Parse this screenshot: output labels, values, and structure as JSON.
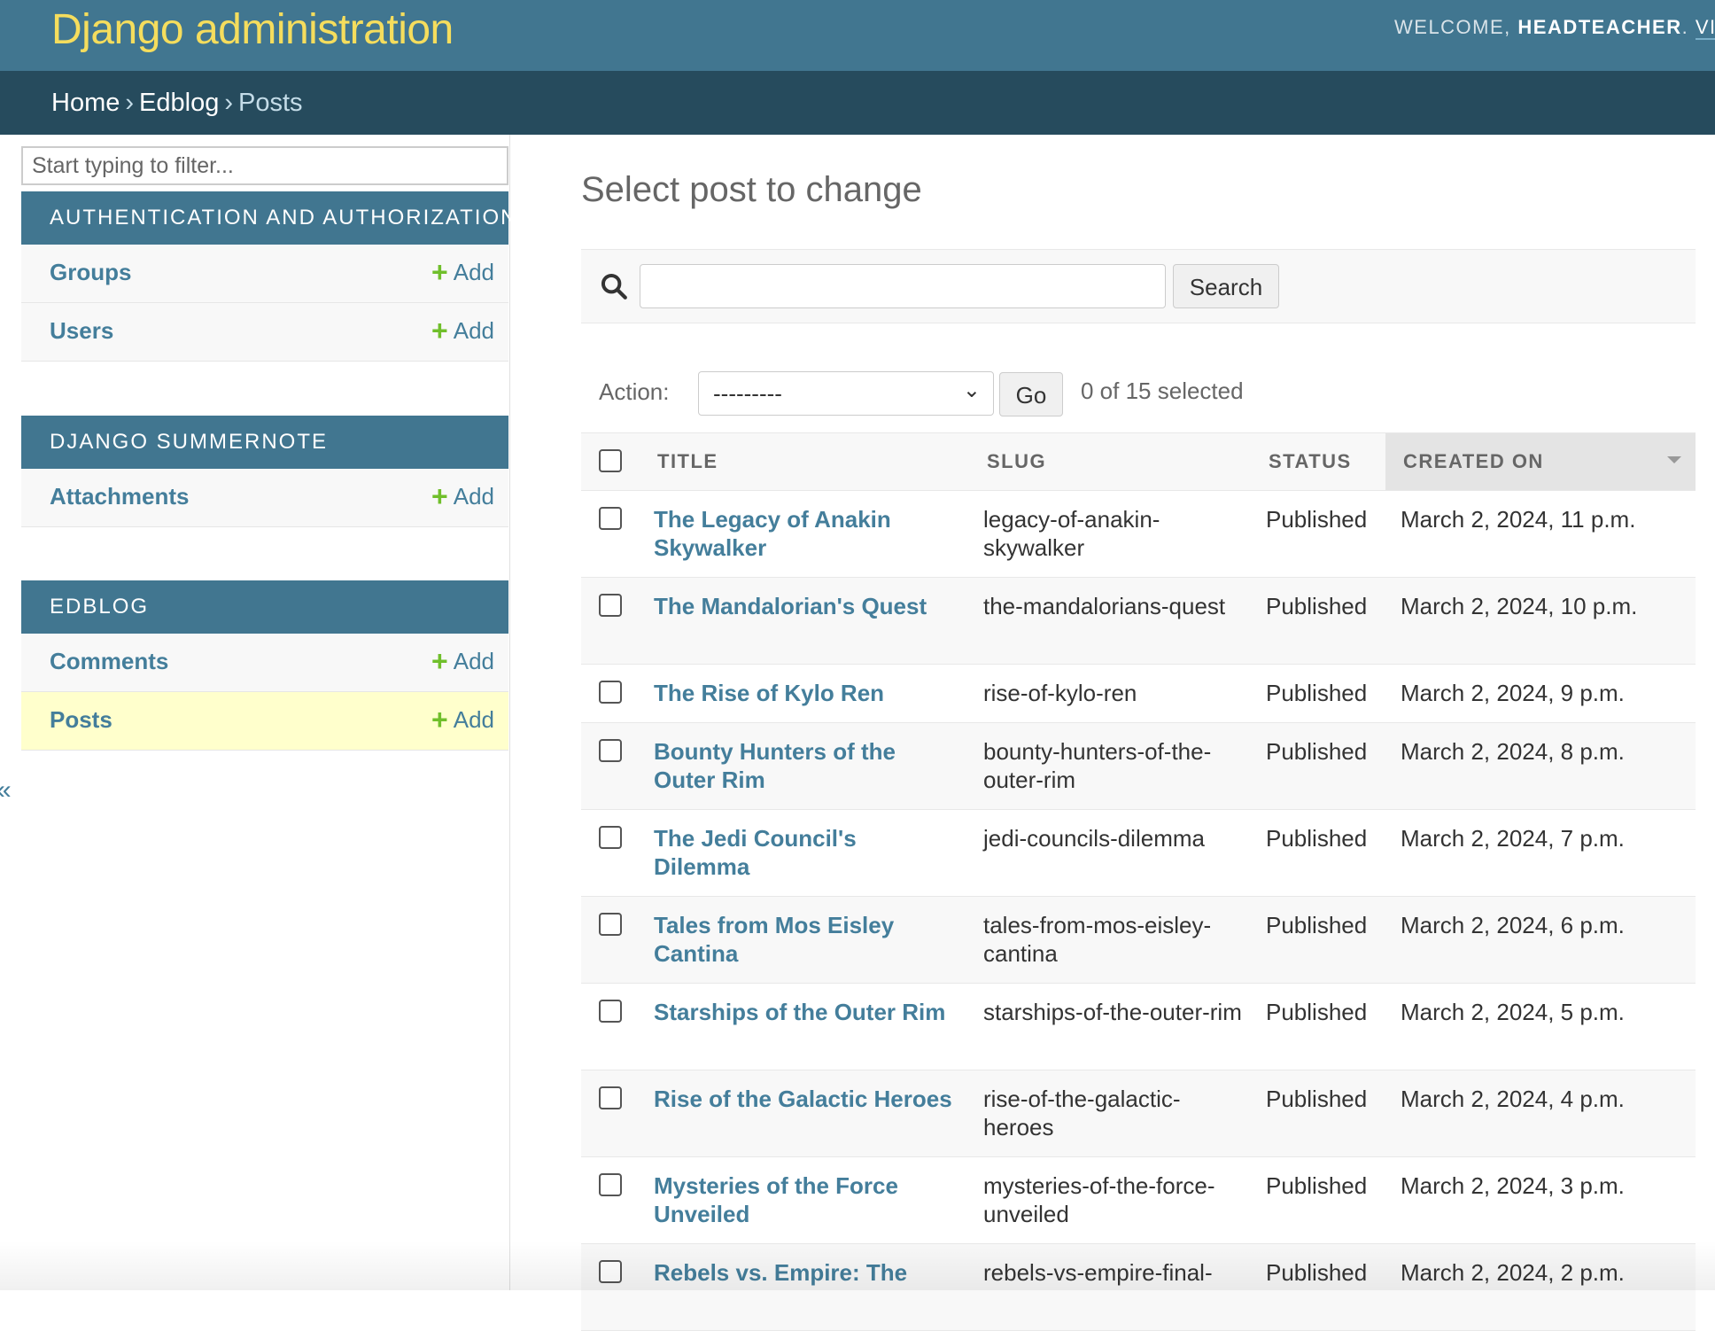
{
  "header": {
    "branding": "Django administration",
    "welcome": "WELCOME, ",
    "username": "HEADTEACHER",
    "after_username": ". ",
    "view_site": "VIEW SITE"
  },
  "breadcrumbs": {
    "items": [
      "Home",
      "Edblog",
      "Posts"
    ],
    "separator": "›"
  },
  "sidebar": {
    "filter_placeholder": "Start typing to filter...",
    "apps": [
      {
        "name": "AUTHENTICATION AND AUTHORIZATION",
        "models": [
          {
            "name": "Groups",
            "add": "Add"
          },
          {
            "name": "Users",
            "add": "Add"
          }
        ]
      },
      {
        "name": "DJANGO SUMMERNOTE",
        "models": [
          {
            "name": "Attachments",
            "add": "Add"
          }
        ]
      },
      {
        "name": "EDBLOG",
        "models": [
          {
            "name": "Comments",
            "add": "Add"
          },
          {
            "name": "Posts",
            "add": "Add",
            "current": true
          }
        ]
      }
    ],
    "toggle_glyph": "«"
  },
  "main": {
    "title": "Select post to change",
    "search": {
      "value": "",
      "button": "Search"
    },
    "actions": {
      "label": "Action:",
      "selected_option": "---------",
      "go": "Go",
      "selected_count": "0 of 15 selected"
    },
    "table": {
      "columns": [
        "TITLE",
        "SLUG",
        "STATUS",
        "CREATED ON"
      ],
      "sorted_column": "CREATED ON",
      "rows": [
        {
          "title": "The Legacy of Anakin Skywalker",
          "slug": "legacy-of-anakin-skywalker",
          "status": "Published",
          "created": "March 2, 2024, 11 p.m."
        },
        {
          "title": "The Mandalorian's Quest",
          "slug": "the-mandalorians-quest",
          "status": "Published",
          "created": "March 2, 2024, 10 p.m."
        },
        {
          "title": "The Rise of Kylo Ren",
          "slug": "rise-of-kylo-ren",
          "status": "Published",
          "created": "March 2, 2024, 9 p.m."
        },
        {
          "title": "Bounty Hunters of the Outer Rim",
          "slug": "bounty-hunters-of-the-outer-rim",
          "status": "Published",
          "created": "March 2, 2024, 8 p.m."
        },
        {
          "title": "The Jedi Council's Dilemma",
          "slug": "jedi-councils-dilemma",
          "status": "Published",
          "created": "March 2, 2024, 7 p.m."
        },
        {
          "title": "Tales from Mos Eisley Cantina",
          "slug": "tales-from-mos-eisley-cantina",
          "status": "Published",
          "created": "March 2, 2024, 6 p.m."
        },
        {
          "title": "Starships of the Outer Rim",
          "slug": "starships-of-the-outer-rim",
          "status": "Published",
          "created": "March 2, 2024, 5 p.m."
        },
        {
          "title": "Rise of the Galactic Heroes",
          "slug": "rise-of-the-galactic-heroes",
          "status": "Published",
          "created": "March 2, 2024, 4 p.m."
        },
        {
          "title": "Mysteries of the Force Unveiled",
          "slug": "mysteries-of-the-force-unveiled",
          "status": "Published",
          "created": "March 2, 2024, 3 p.m."
        },
        {
          "title": "Rebels vs. Empire: The",
          "slug": "rebels-vs-empire-final-",
          "status": "Published",
          "created": "March 2, 2024, 2 p.m."
        }
      ]
    }
  },
  "colors": {
    "header": "#417690",
    "breadcrumbs": "#264b5d",
    "branding": "#f5dd5d",
    "link": "#447e9b",
    "add_plus": "#70bf2b",
    "current_row": "#ffffcc"
  }
}
